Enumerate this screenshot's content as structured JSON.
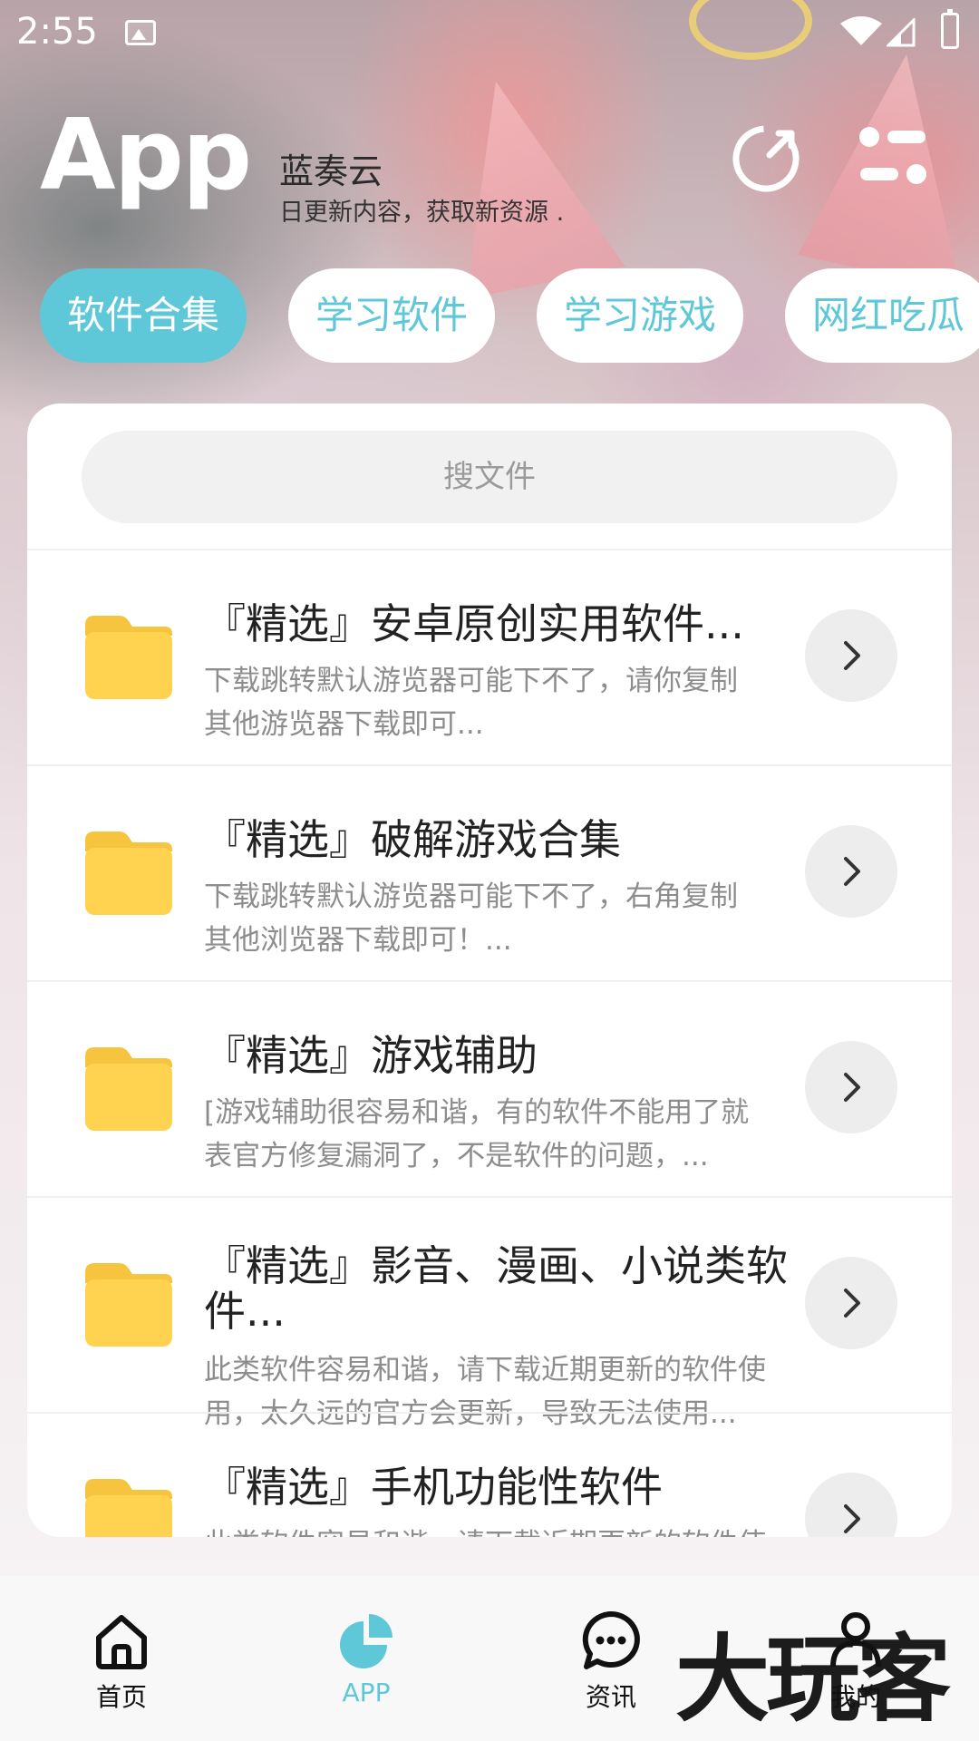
{
  "status_bar": {
    "time": "2:55"
  },
  "header": {
    "title": "App",
    "subtitle": "蓝奏云",
    "description": "日更新内容，获取新资源 ."
  },
  "tabs": [
    {
      "label": "软件合集",
      "active": true
    },
    {
      "label": "学习软件",
      "active": false
    },
    {
      "label": "学习游戏",
      "active": false
    },
    {
      "label": "网红吃瓜",
      "active": false
    }
  ],
  "search": {
    "placeholder": "搜文件"
  },
  "items": [
    {
      "title": "『精选』安卓原创实用软件...",
      "desc": "下载跳转默认游览器可能下不了，请你复制\n其他游览器下载即可..."
    },
    {
      "title": "『精选』破解游戏合集",
      "desc": "下载跳转默认游览器可能下不了，右角复制\n其他浏览器下载即可！..."
    },
    {
      "title": "『精选』游戏辅助",
      "desc": "[游戏辅助很容易和谐，有的软件不能用了就\n表官方修复漏洞了，不是软件的问题，..."
    },
    {
      "title": "『精选』影音、漫画、小说类软件...",
      "desc": "此类软件容易和谐，请下载近期更新的软件使\n用，太久远的官方会更新，导致无法使用..."
    },
    {
      "title": "『精选』手机功能性软件",
      "desc": "此类软件容易和谐，请下载近期更新的软件使"
    }
  ],
  "bottom_nav": [
    {
      "label": "首页",
      "icon": "home-icon",
      "active": false
    },
    {
      "label": "APP",
      "icon": "pie-chart-icon",
      "active": true
    },
    {
      "label": "资讯",
      "icon": "chat-bubble-icon",
      "active": false
    },
    {
      "label": "我的",
      "icon": "person-icon",
      "active": false
    }
  ],
  "watermark": "大玩客",
  "colors": {
    "accent": "#5fc8d8",
    "folder": "#ffd24f"
  }
}
